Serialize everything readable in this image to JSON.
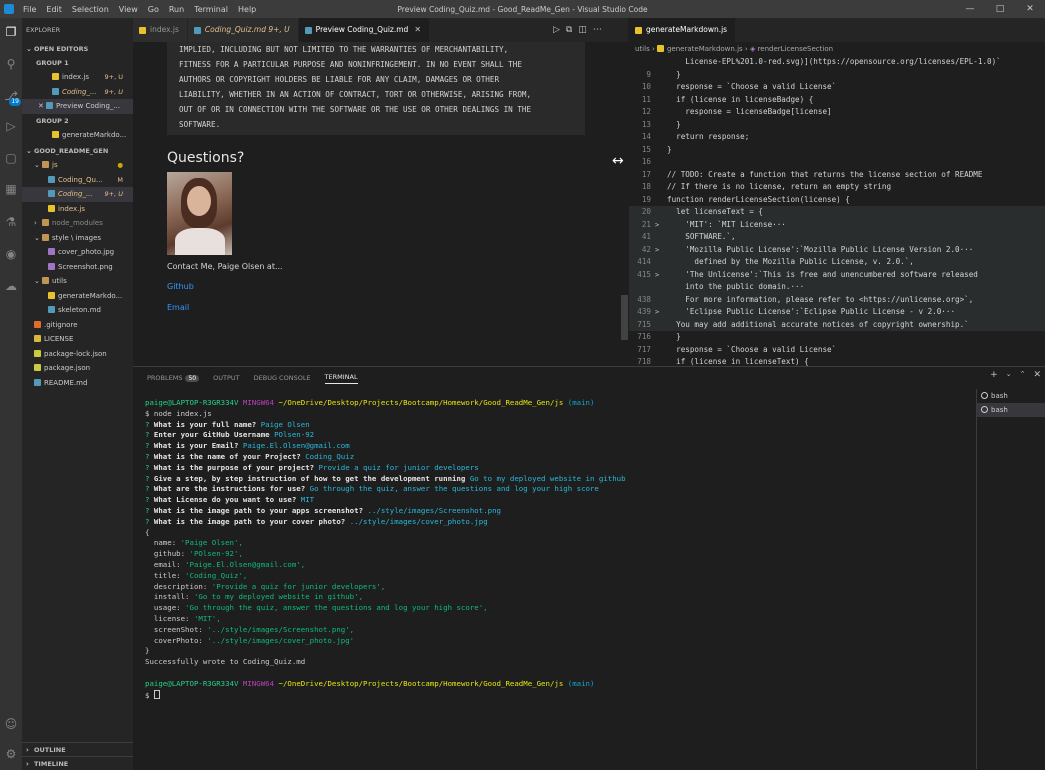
{
  "titlebar": {
    "menu": [
      "File",
      "Edit",
      "Selection",
      "View",
      "Go",
      "Run",
      "Terminal",
      "Help"
    ],
    "window_title": "Preview Coding_Quiz.md - Good_ReadMe_Gen - Visual Studio Code"
  },
  "sidebar": {
    "explorer_label": "EXPLORER",
    "open_editors_label": "OPEN EDITORS",
    "group1_label": "GROUP 1",
    "group1_items": [
      {
        "name": "index.js",
        "suffix": "9+, U"
      },
      {
        "name": "Coding_...",
        "suffix": "9+, U"
      },
      {
        "name": "Preview Coding_...",
        "suffix": ""
      }
    ],
    "group2_label": "GROUP 2",
    "group2_items": [
      {
        "name": "generateMarkdo...",
        "suffix": ""
      }
    ],
    "project_label": "GOOD_README_GEN",
    "tree": [
      {
        "name": "js",
        "suffix": ""
      },
      {
        "name": "Coding_Qu...",
        "suffix": "M"
      },
      {
        "name": "Coding_...",
        "suffix": "9+, U"
      },
      {
        "name": "index.js",
        "suffix": ""
      },
      {
        "name": "node_modules",
        "suffix": ""
      },
      {
        "name": "style \\ images",
        "suffix": ""
      },
      {
        "name": "cover_photo.jpg",
        "suffix": ""
      },
      {
        "name": "Screenshot.png",
        "suffix": ""
      },
      {
        "name": "utils",
        "suffix": ""
      },
      {
        "name": "generateMarkdo...",
        "suffix": ""
      },
      {
        "name": "skeleton.md",
        "suffix": ""
      },
      {
        "name": ".gitignore",
        "suffix": ""
      },
      {
        "name": "LICENSE",
        "suffix": ""
      },
      {
        "name": "package-lock.json",
        "suffix": ""
      },
      {
        "name": "package.json",
        "suffix": ""
      },
      {
        "name": "README.md",
        "suffix": ""
      }
    ],
    "outline_label": "OUTLINE",
    "timeline_label": "TIMELINE"
  },
  "left_tabs": [
    {
      "label": "index.js"
    },
    {
      "label": "Coding_Quiz.md 9+, U"
    },
    {
      "label": "Preview Coding_Quiz.md"
    }
  ],
  "right_tabs": [
    {
      "label": "generateMarkdown.js"
    }
  ],
  "breadcrumb": {
    "a": "utils",
    "b": "generateMarkdown.js",
    "c": "renderLicenseSection"
  },
  "preview": {
    "license_lines": [
      "IMPLIED, INCLUDING BUT NOT LIMITED TO THE WARRANTIES OF MERCHANTABILITY,",
      "FITNESS FOR A PARTICULAR PURPOSE AND NONINFRINGEMENT. IN NO EVENT SHALL THE",
      "AUTHORS OR COPYRIGHT HOLDERS BE LIABLE FOR ANY CLAIM, DAMAGES OR OTHER",
      "LIABILITY, WHETHER IN AN ACTION OF CONTRACT, TORT OR OTHERWISE, ARISING FROM,",
      "OUT OF OR IN CONNECTION WITH THE SOFTWARE OR THE USE OR OTHER DEALINGS IN THE",
      "SOFTWARE."
    ],
    "heading": "Questions?",
    "contact": "Contact Me, Paige Olsen at...",
    "github_link": "Github",
    "email_link": "Email"
  },
  "code_lines": [
    {
      "n": "",
      "fold": "",
      "t": "    License-EPL%201.0-red.svg)](https://opensource.org/licenses/EPL-1.0)`"
    },
    {
      "n": "9",
      "fold": "",
      "t": "  }"
    },
    {
      "n": "10",
      "fold": "",
      "t": "  response = `Choose a valid License`"
    },
    {
      "n": "11",
      "fold": "",
      "t": "  if (license in licenseBadge) {"
    },
    {
      "n": "12",
      "fold": "",
      "t": "    response = licenseBadge[license]"
    },
    {
      "n": "13",
      "fold": "",
      "t": "  }"
    },
    {
      "n": "14",
      "fold": "",
      "t": "  return response;"
    },
    {
      "n": "15",
      "fold": "",
      "t": "}"
    },
    {
      "n": "16",
      "fold": "",
      "t": ""
    },
    {
      "n": "17",
      "fold": "",
      "t": "// TODO: Create a function that returns the license section of README"
    },
    {
      "n": "18",
      "fold": "",
      "t": "// If there is no license, return an empty string"
    },
    {
      "n": "19",
      "fold": "",
      "t": "function renderLicenseSection(license) {"
    },
    {
      "n": "20",
      "fold": "",
      "t": "  let licenseText = {"
    },
    {
      "n": "21",
      "fold": ">",
      "t": "    'MIT': `MIT License···"
    },
    {
      "n": "41",
      "fold": "",
      "t": "    SOFTWARE.`,"
    },
    {
      "n": "42",
      "fold": ">",
      "t": "    'Mozilla Public License':`Mozilla Public License Version 2.0···"
    },
    {
      "n": "414",
      "fold": "",
      "t": "      defined by the Mozilla Public License, v. 2.0.`,"
    },
    {
      "n": "415",
      "fold": ">",
      "t": "    'The Unlicense':`This is free and unencumbered software released"
    },
    {
      "n": "",
      "fold": "",
      "t": "    into the public domain.···"
    },
    {
      "n": "438",
      "fold": "",
      "t": "    For more information, please refer to <https://unlicense.org>`,"
    },
    {
      "n": "439",
      "fold": ">",
      "t": "    'Eclipse Public License':`Eclipse Public License - v 2.0···"
    },
    {
      "n": "715",
      "fold": "",
      "t": "  You may add additional accurate notices of copyright ownership.`"
    },
    {
      "n": "716",
      "fold": "",
      "t": "  }"
    },
    {
      "n": "717",
      "fold": "",
      "t": "  response = `Choose a valid License`"
    },
    {
      "n": "718",
      "fold": "",
      "t": "  if (license in licenseText) {"
    }
  ],
  "panel": {
    "tabs": [
      "PROBLEMS",
      "OUTPUT",
      "DEBUG CONSOLE",
      "TERMINAL"
    ],
    "problems_count": "50",
    "terminals": [
      "bash",
      "bash"
    ]
  },
  "terminal": {
    "prompt_user": "paige@LAPTOP-R3GR334V",
    "prompt_env": "MINGW64",
    "prompt_path": "~/OneDrive/Desktop/Projects/Bootcamp/Homework/Good_ReadMe_Gen/js",
    "prompt_branch": "(main)",
    "command": "$ node index.js",
    "qa": [
      {
        "q": "What is your full name?",
        "a": "Paige Olsen"
      },
      {
        "q": "Enter your GitHub Username",
        "a": "POlsen-92"
      },
      {
        "q": "What is your Email?",
        "a": "Paige.El.Olsen@gmail.com"
      },
      {
        "q": "What is the name of your Project?",
        "a": "Coding_Quiz"
      },
      {
        "q": "What is the purpose of your project?",
        "a": "Provide a quiz for junior developers"
      },
      {
        "q": "Give a step, by step instruction of how to get the development running",
        "a": "Go to my deployed website in github"
      },
      {
        "q": "What are the instructions for use?",
        "a": "Go through the quiz, answer the questions and log your high score"
      },
      {
        "q": "What License do you want to use?",
        "a": "MIT"
      },
      {
        "q": "What is the image path to your apps screenshot?",
        "a": "../style/images/Screenshot.png"
      },
      {
        "q": "What is the image path to your cover photo?",
        "a": "../style/images/cover_photo.jpg"
      }
    ],
    "object_lines": [
      {
        "k": "  name: ",
        "v": "'Paige Olsen',"
      },
      {
        "k": "  github: ",
        "v": "'POlsen-92',"
      },
      {
        "k": "  email: ",
        "v": "'Paige.El.Olsen@gmail.com',"
      },
      {
        "k": "  title: ",
        "v": "'Coding_Quiz',"
      },
      {
        "k": "  description: ",
        "v": "'Provide a quiz for junior developers',"
      },
      {
        "k": "  install: ",
        "v": "'Go to my deployed website in github',"
      },
      {
        "k": "  usage: ",
        "v": "'Go through the quiz, answer the questions and log your high score',"
      },
      {
        "k": "  license: ",
        "v": "'MIT',"
      },
      {
        "k": "  screenShot: ",
        "v": "'../style/images/Screenshot.png',"
      },
      {
        "k": "  coverPhoto: ",
        "v": "'../style/images/cover_photo.jpg'"
      }
    ],
    "success": "Successfully wrote to Coding_Quiz.md",
    "final_prompt": "$ "
  }
}
